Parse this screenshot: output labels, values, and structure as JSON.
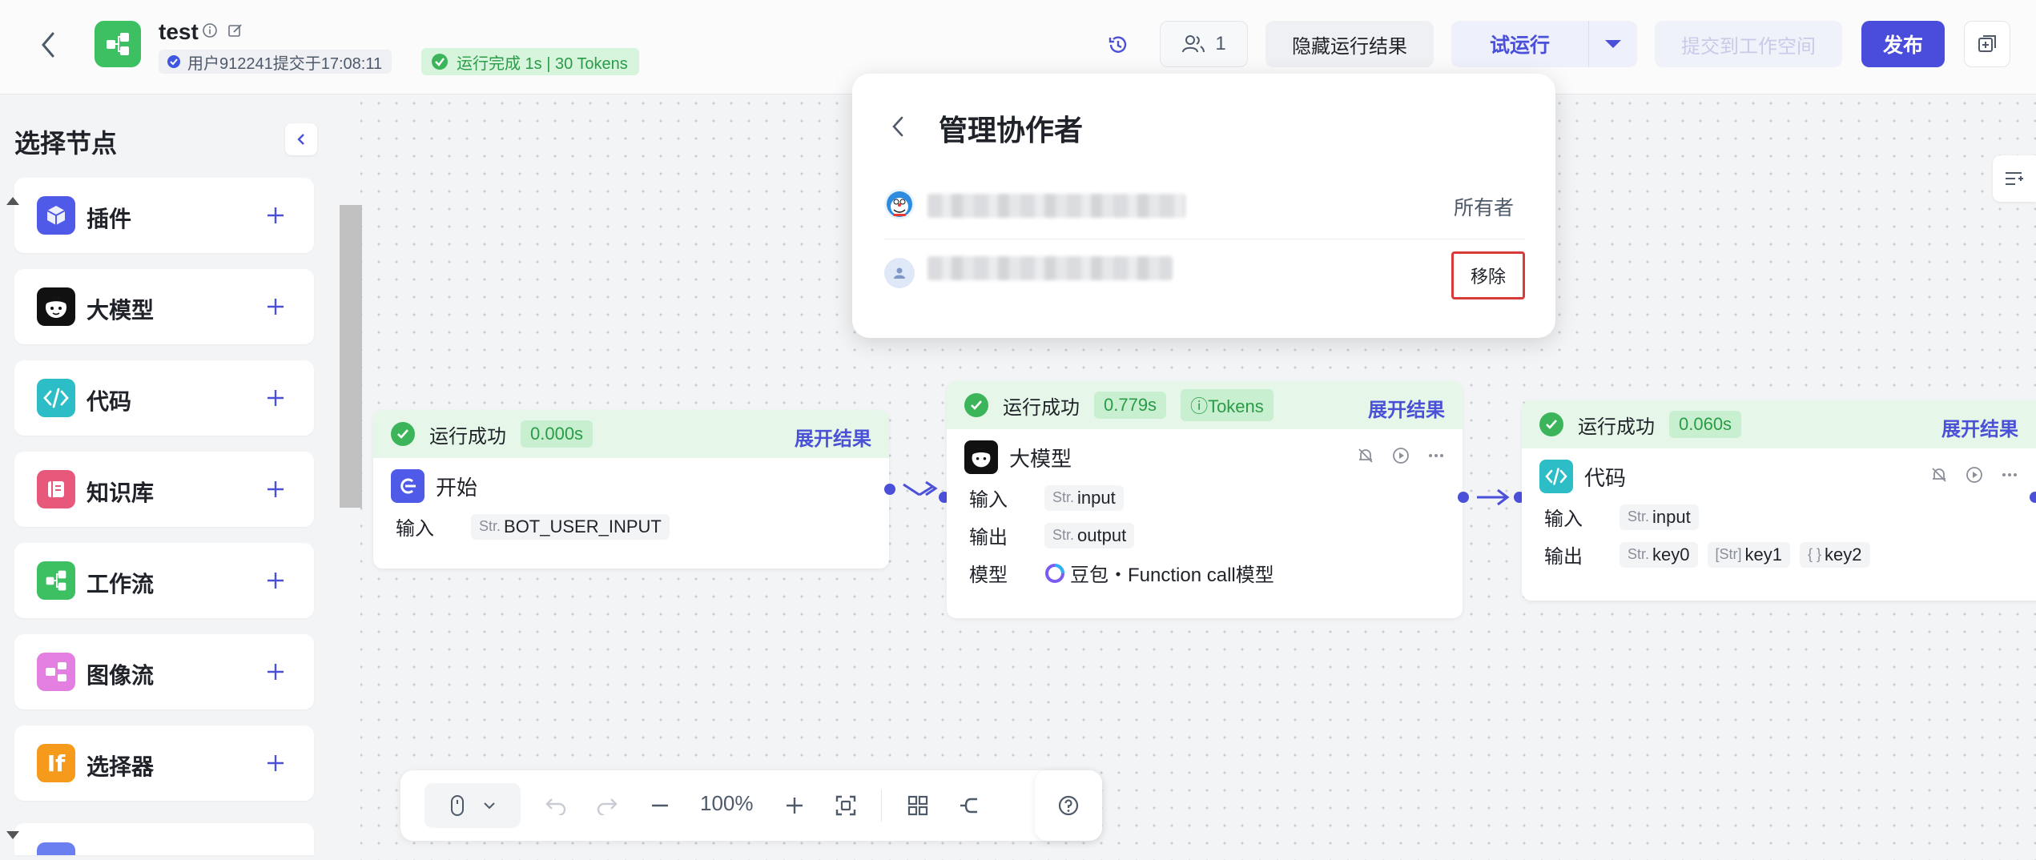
{
  "header": {
    "title": "test",
    "meta": "用户912241提交于17:08:11",
    "run_status": "运行完成 1s | 30 Tokens",
    "collaborator_count": "1",
    "hide_results_label": "隐藏运行结果",
    "trial_run_label": "试运行",
    "submit_label": "提交到工作空间",
    "publish_label": "发布"
  },
  "sidebar": {
    "title": "选择节点",
    "items": [
      {
        "label": "插件",
        "icon": "plugin-icon",
        "color": "#4f5be8"
      },
      {
        "label": "大模型",
        "icon": "llm-icon",
        "color": "#111111"
      },
      {
        "label": "代码",
        "icon": "code-icon",
        "color": "#2dbdc7"
      },
      {
        "label": "知识库",
        "icon": "knowledge-icon",
        "color": "#e8587a"
      },
      {
        "label": "工作流",
        "icon": "workflow-icon",
        "color": "#3cc061"
      },
      {
        "label": "图像流",
        "icon": "imageflow-icon",
        "color": "#e27fe0"
      },
      {
        "label": "选择器",
        "icon": "selector-icon",
        "color": "#f59a1b"
      }
    ]
  },
  "nodes": {
    "start": {
      "status": "运行成功",
      "duration": "0.000s",
      "expand": "展开结果",
      "title": "开始",
      "input_label": "输入",
      "input_type": "Str.",
      "input_value": "BOT_USER_INPUT"
    },
    "llm": {
      "status": "运行成功",
      "duration": "0.779s",
      "tokens": "ⓘTokens",
      "expand": "展开结果",
      "title": "大模型",
      "input_label": "输入",
      "input_type": "Str.",
      "input_value": "input",
      "output_label": "输出",
      "output_type": "Str.",
      "output_value": "output",
      "model_label": "模型",
      "model_value": "豆包・Function call模型"
    },
    "code": {
      "status": "运行成功",
      "duration": "0.060s",
      "expand": "展开结果",
      "title": "代码",
      "input_label": "输入",
      "input_type": "Str.",
      "input_value": "input",
      "output_label": "输出",
      "outputs": [
        {
          "type": "Str.",
          "name": "key0"
        },
        {
          "type": "[Str]",
          "name": "key1"
        },
        {
          "type": "{ }",
          "name": "key2"
        }
      ]
    }
  },
  "toolbar": {
    "zoom": "100%"
  },
  "popover": {
    "title": "管理协作者",
    "owner_role": "所有者",
    "remove_label": "移除"
  },
  "colors": {
    "accent": "#4a4ddb",
    "success": "#3cb55a",
    "highlight_border": "#d93a3a"
  }
}
